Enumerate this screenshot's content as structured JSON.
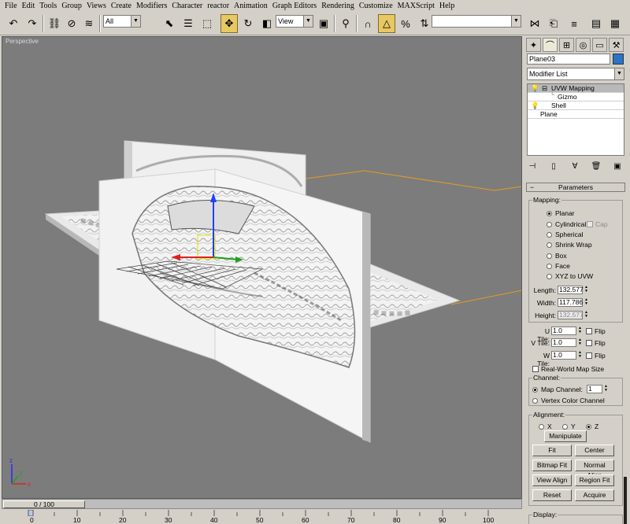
{
  "menu": [
    "File",
    "Edit",
    "Tools",
    "Group",
    "Views",
    "Create",
    "Modifiers",
    "Character",
    "reactor",
    "Animation",
    "Graph Editors",
    "Rendering",
    "Customize",
    "MAXScript",
    "Help"
  ],
  "toolbar": {
    "selection_filter": "All",
    "ref_coord": "View",
    "named_selection": ""
  },
  "viewport": {
    "label": "Perspective",
    "axis_x": "x",
    "axis_y": "y",
    "axis_z": "z"
  },
  "panel": {
    "object_name": "Plane03",
    "object_color": "#2a74c8",
    "modifier_list": "Modifier List",
    "stack": [
      {
        "label": "UVW Mapping",
        "selected": true
      },
      {
        "label": "Gizmo",
        "selected": false
      },
      {
        "label": "Shell",
        "selected": false
      },
      {
        "label": "Plane",
        "selected": false
      }
    ],
    "rollout_title": "Parameters",
    "mapping_group": "Mapping:",
    "mapping_options": [
      "Planar",
      "Cylindrical",
      "Spherical",
      "Shrink Wrap",
      "Box",
      "Face",
      "XYZ to UVW"
    ],
    "mapping_selected": "Planar",
    "cap_label": "Cap",
    "length_label": "Length:",
    "length_value": "132.577",
    "width_label": "Width:",
    "width_value": "117.786",
    "height_label": "Height:",
    "height_value": "132.577",
    "u_tile_label": "U Tile:",
    "u_tile_value": "1.0",
    "v_tile_label": "V Tile:",
    "v_tile_value": "1.0",
    "w_tile_label": "W Tile:",
    "w_tile_value": "1.0",
    "flip_label": "Flip",
    "real_world_label": "Real-World Map Size",
    "channel_group": "Channel:",
    "map_channel_label": "Map Channel:",
    "map_channel_value": "1",
    "vertex_color_label": "Vertex Color Channel",
    "alignment_group": "Alignment:",
    "align_x": "X",
    "align_y": "Y",
    "align_z": "Z",
    "align_selected": "Z",
    "manipulate_label": "Manipulate",
    "fit_label": "Fit",
    "center_label": "Center",
    "bitmap_fit_label": "Bitmap Fit",
    "normal_align_label": "Normal Align",
    "view_align_label": "View Align",
    "region_fit_label": "Region Fit",
    "reset_label": "Reset",
    "acquire_label": "Acquire",
    "display_group": "Display:"
  },
  "timeline": {
    "slider_text": "0 / 100",
    "ticks": [
      "0",
      "10",
      "20",
      "30",
      "40",
      "50",
      "60",
      "70",
      "80",
      "90",
      "100"
    ]
  }
}
